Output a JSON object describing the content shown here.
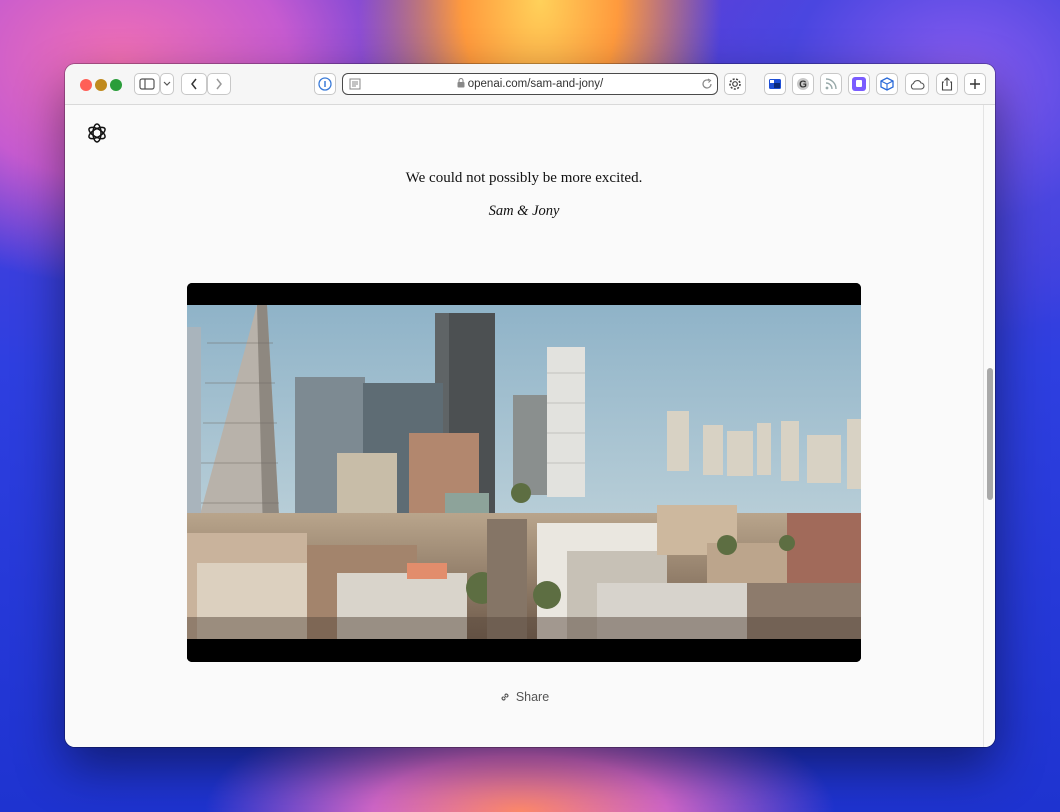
{
  "browser": {
    "url": "openai.com/sam-and-jony/",
    "traffic_lights": {
      "close": "#ff5f57",
      "minimize": "#febc2e",
      "zoom": "#28c840"
    }
  },
  "page": {
    "logo_icon": "openai-logo-icon",
    "headline": "We could not possibly be more excited.",
    "signature": "Sam & Jony",
    "share_label": "Share"
  },
  "colors": {
    "accent": "#3b82f6",
    "page_bg": "#fafafa"
  }
}
